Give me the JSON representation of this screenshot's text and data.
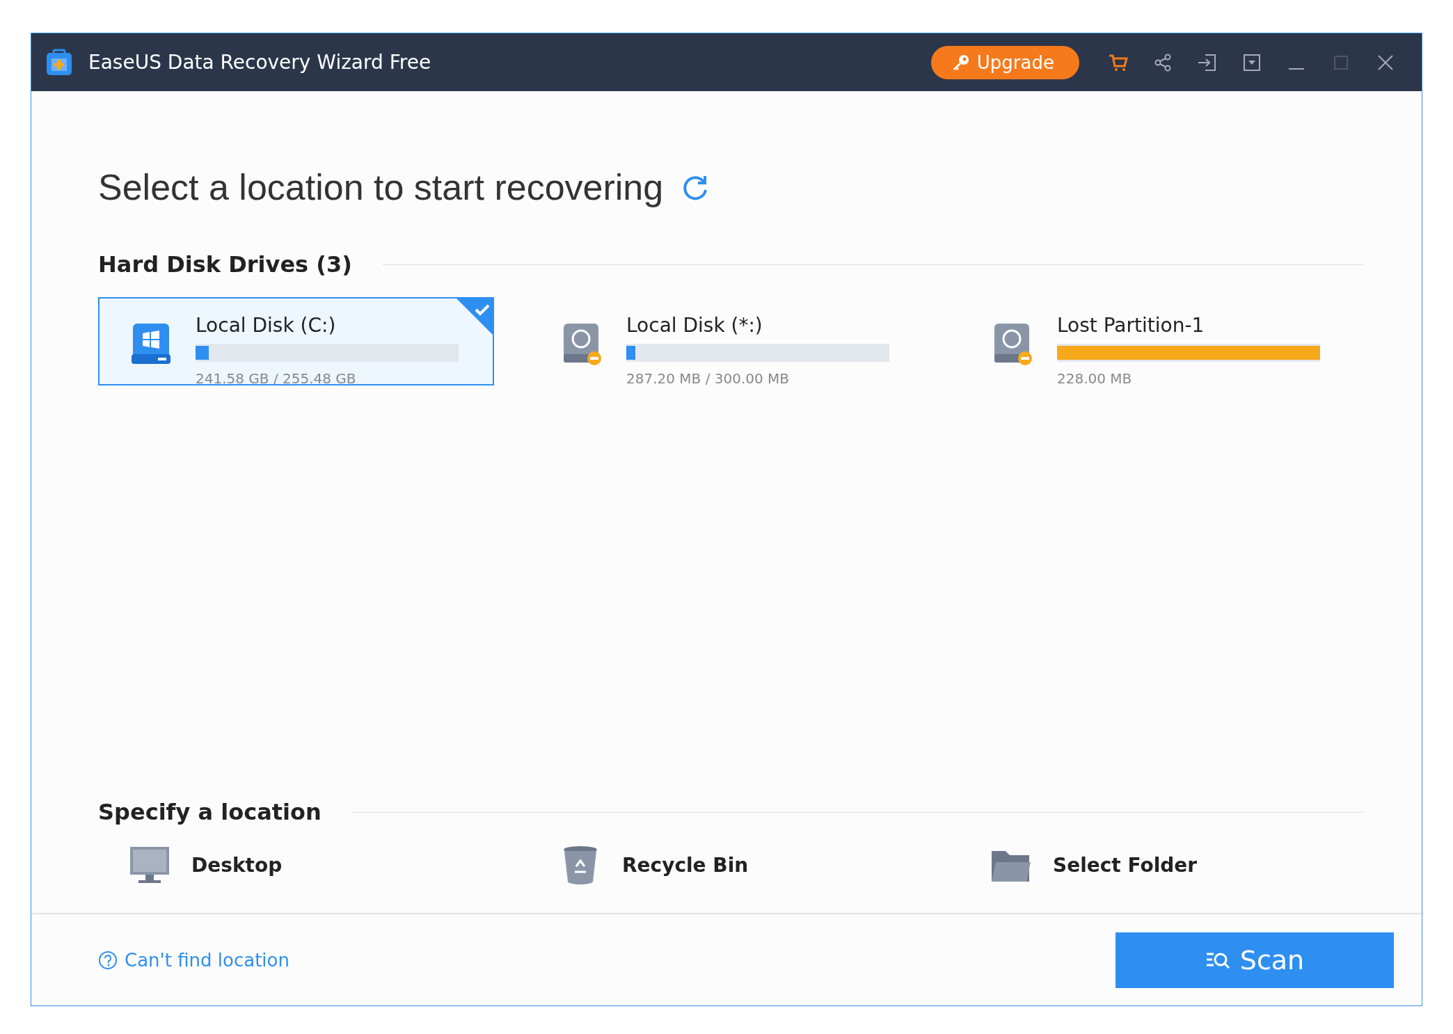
{
  "window": {
    "title": "EaseUS Data Recovery Wizard Free",
    "upgrade_button": "Upgrade"
  },
  "heading": "Select a location to start recovering",
  "hard_disk_drives": {
    "title": "Hard Disk Drives (3)",
    "drives": [
      {
        "name": "Local Disk (C:)",
        "size": "241.58 GB / 255.48 GB",
        "level": 0.05,
        "kind": "windows",
        "color": "#2f8ff0",
        "selected": true
      },
      {
        "name": "Local Disk (*:)",
        "size": "287.20 MB / 300.00 MB",
        "level": 0.035,
        "kind": "disk",
        "color": "#2f8ff0",
        "selected": false
      },
      {
        "name": "Lost Partition-1",
        "size": "228.00 MB",
        "level": 1,
        "kind": "disk",
        "color": "#f7a81b",
        "selected": false
      }
    ]
  },
  "specify_location": {
    "title": "Specify a location",
    "items": [
      {
        "label": "Desktop",
        "kind": "desktop"
      },
      {
        "label": "Recycle Bin",
        "kind": "recycle"
      },
      {
        "label": "Select Folder",
        "kind": "folder"
      }
    ]
  },
  "footer": {
    "help_link": "Can't find location",
    "scan_button": "Scan"
  }
}
